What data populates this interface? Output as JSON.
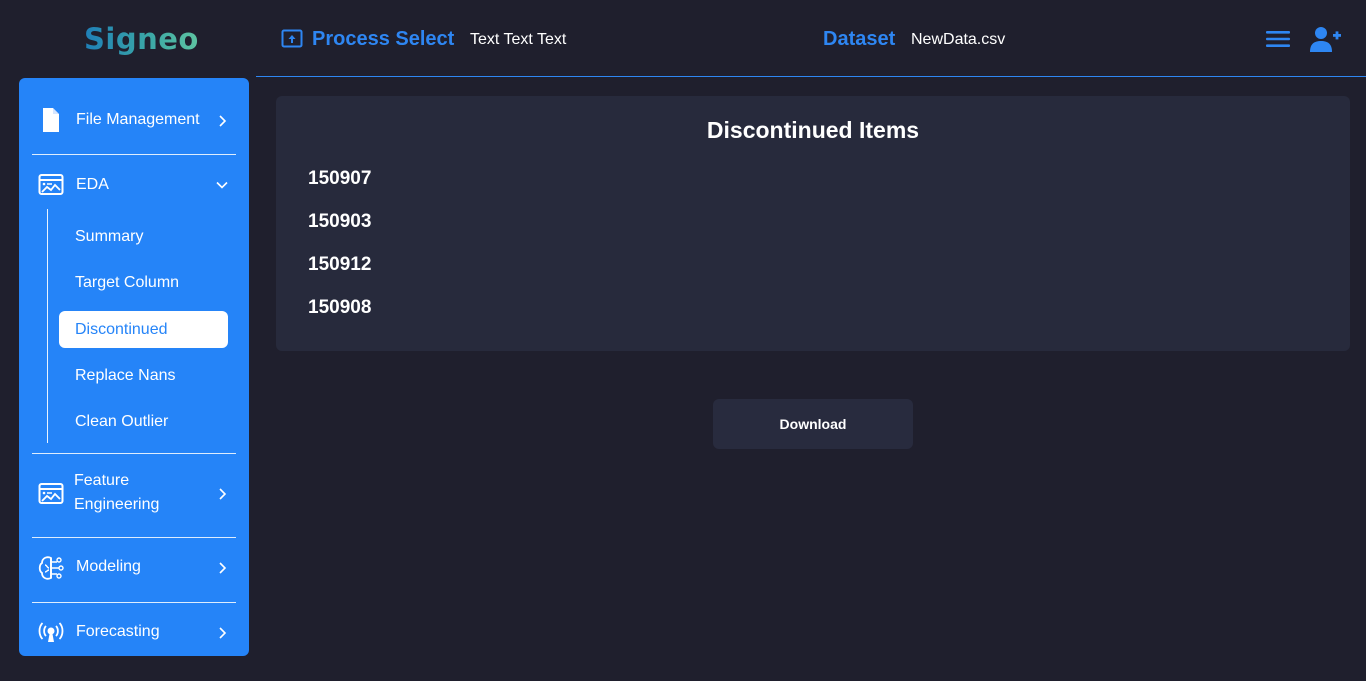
{
  "app": {
    "logo_text": "Signeo"
  },
  "header": {
    "process_label": "Process Select",
    "process_value": "Text Text Text",
    "dataset_label": "Dataset",
    "dataset_value": "NewData.csv",
    "icons": {
      "process": "upload-box-icon",
      "menu": "hamburger-menu-icon",
      "user": "add-user-icon"
    }
  },
  "sidebar": {
    "items": [
      {
        "label": "File Management",
        "icon": "file-icon",
        "expanded": false
      },
      {
        "label": "EDA",
        "icon": "chart-board-icon",
        "expanded": true,
        "children": [
          {
            "label": "Summary",
            "active": false
          },
          {
            "label": "Target Column",
            "active": false
          },
          {
            "label": "Discontinued",
            "active": true
          },
          {
            "label": "Replace Nans",
            "active": false
          },
          {
            "label": "Clean Outlier",
            "active": false
          }
        ]
      },
      {
        "label": "Feature Engineering",
        "label_line1": "Feature",
        "label_line2": "Engineering",
        "icon": "chart-board-icon",
        "expanded": false
      },
      {
        "label": "Modeling",
        "icon": "brain-circuit-icon",
        "expanded": false
      },
      {
        "label": "Forecasting",
        "icon": "broadcast-icon",
        "expanded": false
      }
    ]
  },
  "main": {
    "panel_title": "Discontinued Items",
    "items": [
      "150907",
      "150903",
      "150912",
      "150908"
    ],
    "download_label": "Download"
  },
  "colors": {
    "background": "#1f1f2d",
    "accent": "#2e86f2",
    "sidebar": "#2584f8",
    "panel": "#272a3c"
  }
}
